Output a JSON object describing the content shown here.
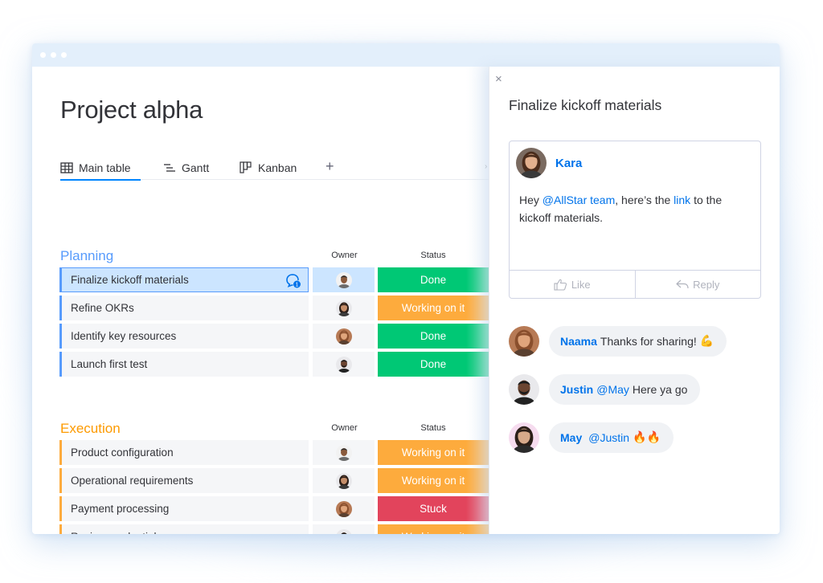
{
  "window": {
    "title_dots": 3
  },
  "board": {
    "title": "Project alpha",
    "tabs": [
      {
        "label": "Main table",
        "icon": "table-icon",
        "active": true
      },
      {
        "label": "Gantt",
        "icon": "gantt-icon",
        "active": false
      },
      {
        "label": "Kanban",
        "icon": "kanban-icon",
        "active": false
      }
    ],
    "add_tab_label": "+",
    "more_label": "›",
    "columns": {
      "owner": "Owner",
      "status": "Status"
    },
    "groups": [
      {
        "title": "Planning",
        "color": "#579bfc",
        "items": [
          {
            "name": "Finalize kickoff materials",
            "owner": "man-short-hair",
            "status": "Done",
            "selected": true,
            "updates": "1"
          },
          {
            "name": "Refine OKRs",
            "owner": "woman-dark-hair",
            "status": "Working on it"
          },
          {
            "name": "Identify key resources",
            "owner": "woman-curly-hair",
            "status": "Done"
          },
          {
            "name": "Launch first test",
            "owner": "man-beard",
            "status": "Done"
          }
        ]
      },
      {
        "title": "Execution",
        "color": "#fdab3d",
        "items": [
          {
            "name": "Product configuration",
            "owner": "man-short-hair",
            "status": "Working on it"
          },
          {
            "name": "Operational requirements",
            "owner": "woman-dark-hair",
            "status": "Working on it"
          },
          {
            "name": "Payment processing",
            "owner": "woman-curly-hair",
            "status": "Stuck"
          },
          {
            "name": "Review credentials",
            "owner": "man-beard",
            "status": "Working on it"
          }
        ]
      }
    ],
    "status_colors": {
      "Done": "#00c875",
      "Working on it": "#fdab3d",
      "Stuck": "#e2445c"
    }
  },
  "panel": {
    "close_label": "×",
    "title": "Finalize kickoff materials",
    "update": {
      "author": "Kara",
      "text_parts": [
        {
          "t": "Hey ",
          "mention": false
        },
        {
          "t": "@AllStar team",
          "mention": true
        },
        {
          "t": ", here’s the ",
          "mention": false
        },
        {
          "t": "link",
          "mention": true
        },
        {
          "t": " to the kickoff materials.",
          "mention": false
        }
      ],
      "like_label": "Like",
      "reply_label": "Reply"
    },
    "replies": [
      {
        "author": "Naama",
        "mention": "",
        "text": "Thanks for sharing!",
        "emoji": "💪"
      },
      {
        "author": "Justin",
        "mention": "@May",
        "text": "Here ya go",
        "emoji": ""
      },
      {
        "author": "May",
        "mention": "@Justin",
        "text": "",
        "emoji": "🔥🔥"
      }
    ]
  }
}
